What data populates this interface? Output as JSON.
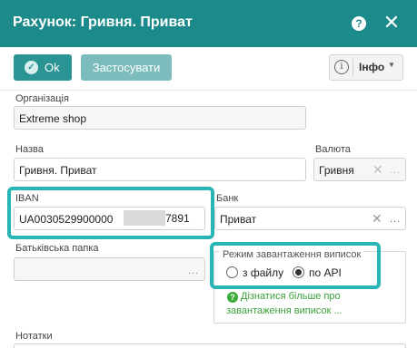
{
  "dialog": {
    "title": "Рахунок: Гривня. Приват",
    "help_icon": "help-icon",
    "close_icon": "close-icon"
  },
  "toolbar": {
    "ok_label": "Ok",
    "apply_label": "Застосувати",
    "info_label": "Інфо"
  },
  "form": {
    "organization": {
      "label": "Організація",
      "value": "Extreme shop"
    },
    "name": {
      "label": "Назва",
      "value": "Гривня. Приват"
    },
    "currency": {
      "label": "Валюта",
      "value": "Гривня"
    },
    "iban": {
      "label": "IBAN",
      "value_start": "UA0030529900000",
      "value_end": "7891"
    },
    "bank": {
      "label": "Банк",
      "value": "Приват"
    },
    "parent_folder": {
      "label": "Батьківська папка",
      "value": ""
    },
    "import_mode": {
      "legend": "Режим завантаження виписок",
      "options": [
        "з файлу",
        "по API"
      ],
      "selected": "по API"
    },
    "learn_more": {
      "line1": "Дізнатися більше про",
      "line2": "завантаження виписок ..."
    },
    "notes": {
      "label": "Нотатки"
    }
  },
  "colors": {
    "header": "#1c8a8a",
    "primary_button": "#2a9494",
    "highlight": "#29b5b5",
    "link": "#3aa03a"
  }
}
